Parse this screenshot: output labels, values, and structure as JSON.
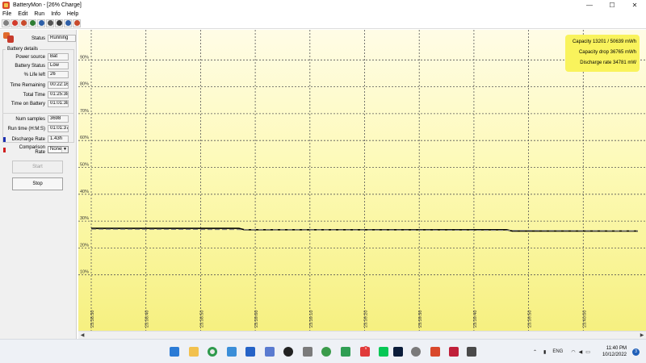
{
  "window": {
    "title": "BatteryMon - [26% Charge]"
  },
  "menu": [
    "File",
    "Edit",
    "Run",
    "Info",
    "Help"
  ],
  "toolbar": {
    "buttons": [
      {
        "name": "circle-grey-icon",
        "color": "#808080"
      },
      {
        "name": "stop-red-icon",
        "color": "#d33b2c"
      },
      {
        "name": "battery-icon",
        "color": "#c94a2c"
      },
      {
        "name": "graph-icon",
        "color": "#2e7d32"
      },
      {
        "name": "list-icon",
        "color": "#2d5fa8"
      },
      {
        "name": "printer-icon",
        "color": "#555555"
      },
      {
        "name": "eye-icon",
        "color": "#3a3a3a"
      },
      {
        "name": "help-icon",
        "color": "#2d5fa8"
      },
      {
        "name": "battery-small-icon",
        "color": "#c94a2c"
      }
    ]
  },
  "status": {
    "label": "Status",
    "value": "Running"
  },
  "battery_details": {
    "title": "Battery details",
    "fields": [
      {
        "label": "Power source",
        "value": "Bat"
      },
      {
        "label": "Battery Status",
        "value": "Low"
      },
      {
        "label": "% Life left",
        "value": "26"
      },
      {
        "label": "Time Remaining",
        "value": "00:22:16"
      },
      {
        "label": "Total Time",
        "value": "01:25:38"
      },
      {
        "label": "Time on Battery",
        "value": "01:01:38"
      }
    ]
  },
  "samples": {
    "label": "Num samples",
    "value": "3698"
  },
  "runtime": {
    "label": "Run time (H:M:S)",
    "value": "01:01:37"
  },
  "discharge": {
    "label": "Discharge Rate",
    "value": "1.43h",
    "color": "#1c2fb0"
  },
  "comparison": {
    "label": "Comparison Rate",
    "value": "None",
    "color": "#d01f1f"
  },
  "buttons": {
    "start": "Start",
    "stop": "Stop"
  },
  "info": {
    "capacity": "Capacity 13201 / 50639 mWh",
    "drop": "Capacity drop 36765 mWh",
    "rate": "Discharge rate 34781 mW"
  },
  "chart_data": {
    "type": "line",
    "y_tick_labels": [
      "90%",
      "80%",
      "70%",
      "60%",
      "50%",
      "40%",
      "30%",
      "20%",
      "10%"
    ],
    "ylim": [
      0,
      100
    ],
    "x_tick_labels": [
      "23:38:30",
      "23:38:40",
      "23:38:50",
      "23:39:00",
      "23:39:10",
      "23:39:20",
      "23:39:30",
      "23:39:40",
      "23:39:50",
      "23:40:00"
    ],
    "grid": true,
    "series": [
      {
        "style": "solid",
        "color": "#000000",
        "points": [
          [
            0,
            27.3
          ],
          [
            2.7,
            27.3
          ],
          [
            2.8,
            26.8
          ],
          [
            7.6,
            26.8
          ],
          [
            7.7,
            26.3
          ],
          [
            10,
            26.3
          ]
        ]
      },
      {
        "style": "dashed",
        "color": "#888888",
        "points": [
          [
            0,
            27.0
          ],
          [
            10,
            26.4
          ]
        ]
      }
    ]
  },
  "taskbar": {
    "language": "ENG",
    "time": "11:40 PM",
    "date": "10/12/2022",
    "notifications": "3",
    "badge": "5"
  },
  "colors": {
    "plot_top": "#fffce6",
    "plot_bottom": "#f6f080",
    "info_bg": "#f9f35c"
  }
}
